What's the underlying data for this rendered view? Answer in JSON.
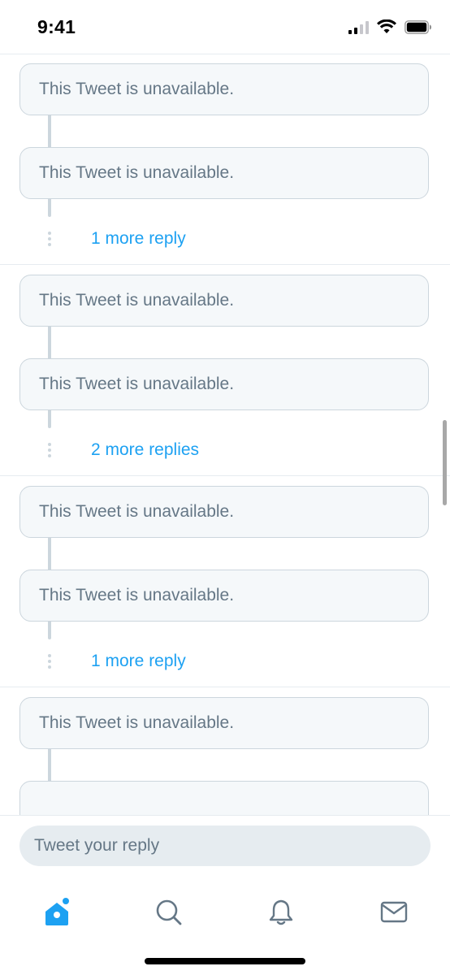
{
  "status_bar": {
    "time": "9:41",
    "icons": [
      "cellular-signal-icon",
      "wifi-icon",
      "battery-icon"
    ]
  },
  "threads": [
    {
      "tweets": [
        "This Tweet is unavailable.",
        "This Tweet is unavailable."
      ],
      "more_replies": "1 more reply"
    },
    {
      "tweets": [
        "This Tweet is unavailable.",
        "This Tweet is unavailable."
      ],
      "more_replies": "2 more replies"
    },
    {
      "tweets": [
        "This Tweet is unavailable.",
        "This Tweet is unavailable."
      ],
      "more_replies": "1 more reply"
    },
    {
      "tweets": [
        "This Tweet is unavailable."
      ]
    }
  ],
  "composer": {
    "placeholder": "Tweet your reply",
    "value": ""
  },
  "tab_bar": {
    "tabs": [
      {
        "icon": "home-icon",
        "active": true,
        "has_notification_dot": true
      },
      {
        "icon": "search-icon",
        "active": false
      },
      {
        "icon": "bell-icon",
        "active": false
      },
      {
        "icon": "mail-icon",
        "active": false
      }
    ]
  },
  "colors": {
    "accent": "#1da1f2",
    "card_background": "#f5f8fa",
    "card_border": "#ccd6dd",
    "muted_text": "#657786",
    "divider": "#e6ecf0",
    "inactive_icon": "#657786"
  }
}
